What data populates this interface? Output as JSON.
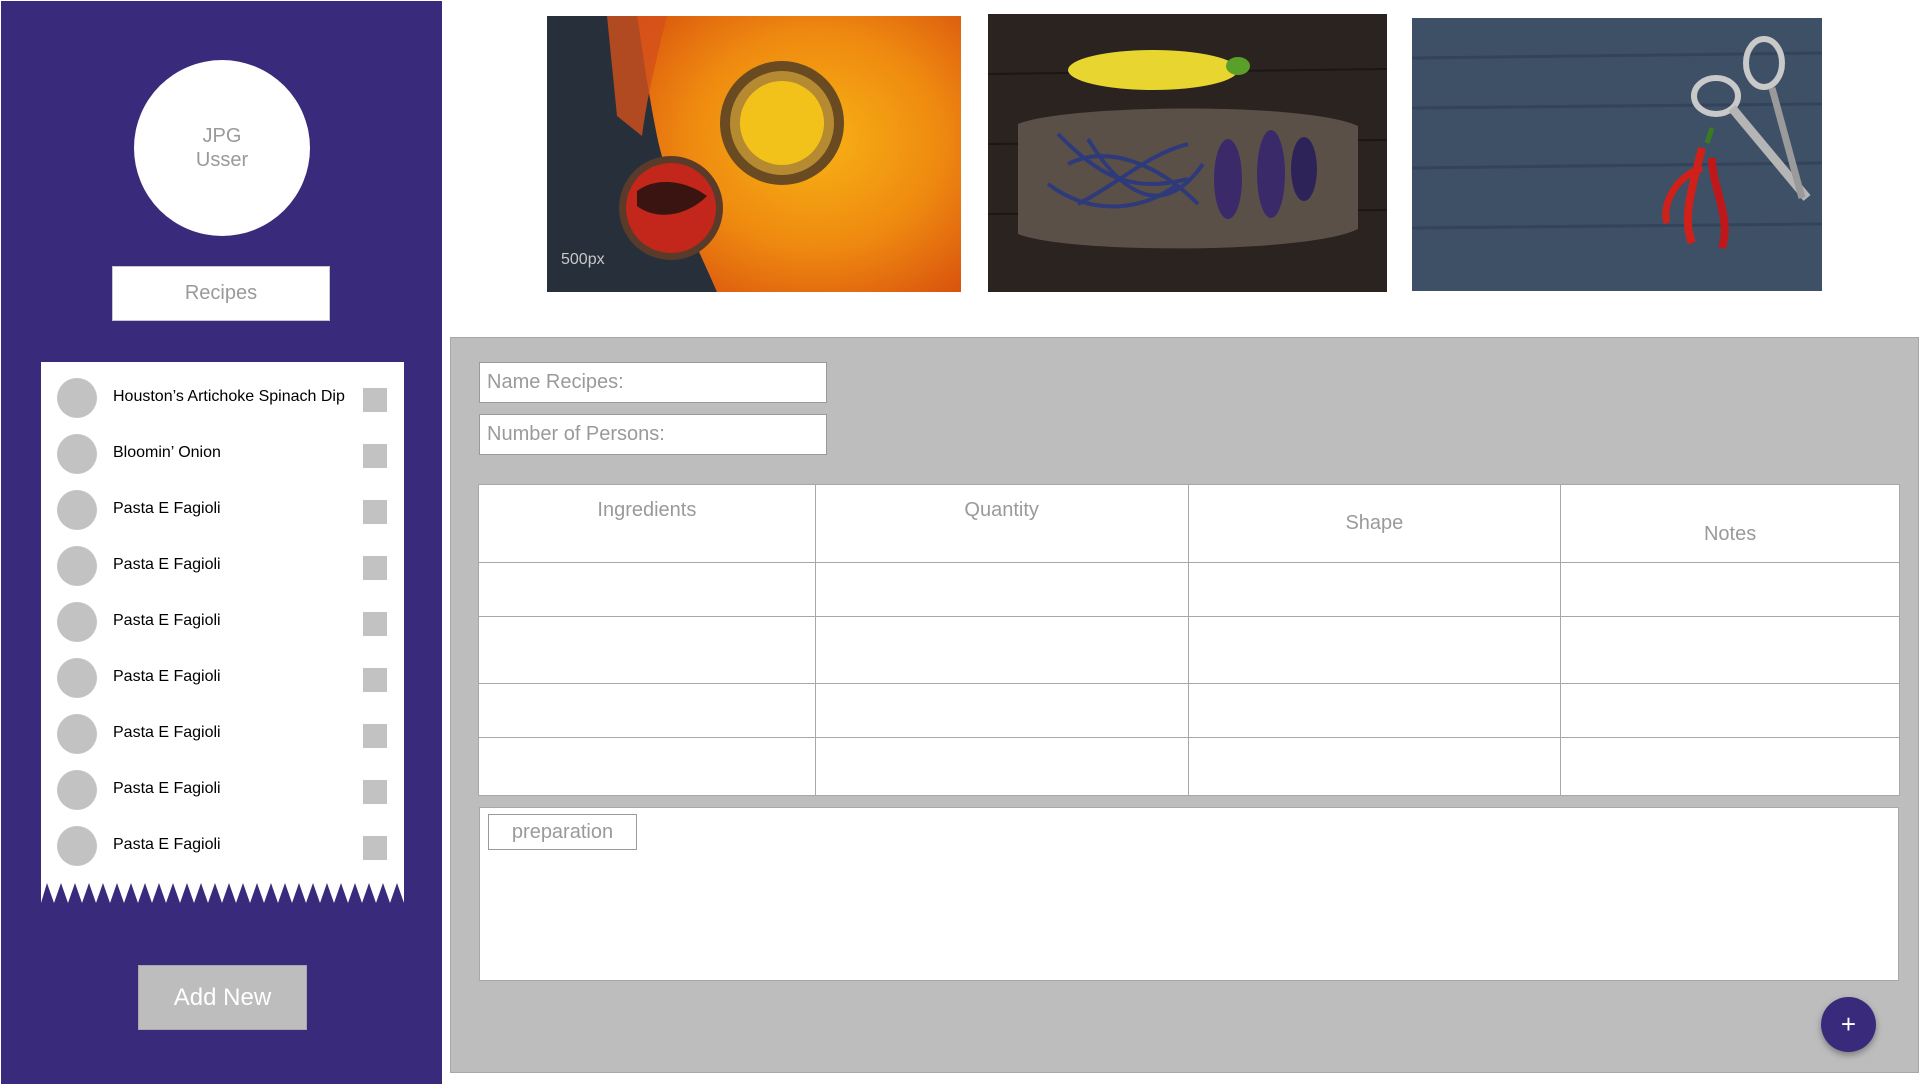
{
  "user": {
    "avatar_line1": "JPG",
    "avatar_line2": "Usser"
  },
  "sidebar": {
    "recipes_button": "Recipes",
    "add_new_button": "Add New",
    "items": [
      {
        "label": "Houston’s Artichoke Spinach Dip"
      },
      {
        "label": "Bloomin’ Onion"
      },
      {
        "label": "Pasta E Fagioli"
      },
      {
        "label": "Pasta E Fagioli"
      },
      {
        "label": "Pasta E Fagioli"
      },
      {
        "label": "Pasta E Fagioli"
      },
      {
        "label": "Pasta E Fagioli"
      },
      {
        "label": "Pasta E Fagioli"
      },
      {
        "label": "Pasta E Fagioli"
      }
    ]
  },
  "photos": [
    {
      "name": "spices-photo",
      "watermark": "500px"
    },
    {
      "name": "vegetables-photo"
    },
    {
      "name": "chili-scissors-photo"
    }
  ],
  "form": {
    "name_placeholder": "Name Recipes:",
    "persons_placeholder": "Number of Persons:",
    "table_headers": [
      "Ingredients",
      "Quantity",
      "Shape",
      "Notes"
    ],
    "preparation_label": "preparation",
    "fab_icon": "plus-icon",
    "fab_symbol": "+"
  },
  "colors": {
    "brand": "#3a2a7c",
    "panel": "#bdbdbd",
    "placeholder_text": "#9a9a9a"
  }
}
